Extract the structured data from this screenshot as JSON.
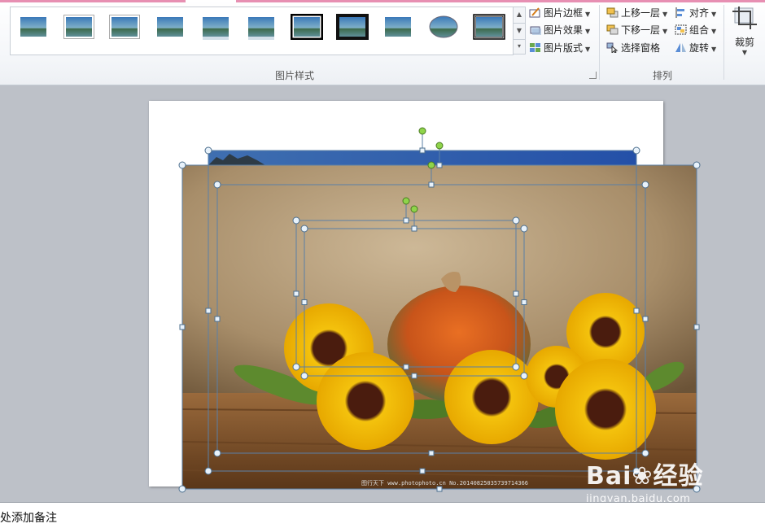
{
  "ribbon": {
    "gallery": {
      "styles": [
        "plain",
        "white-border",
        "soft-frame",
        "soft-edge",
        "reflection",
        "soft-reflection",
        "thick-black-frame",
        "black-frame",
        "thin-frame",
        "oval",
        "double-frame"
      ]
    },
    "picture_styles": {
      "border_label": "图片边框",
      "effects_label": "图片效果",
      "layout_label": "图片版式",
      "group_label": "图片样式"
    },
    "arrange": {
      "bring_forward_label": "上移一层",
      "send_backward_label": "下移一层",
      "selection_pane_label": "选择窗格",
      "align_label": "对齐",
      "group_label_btn": "组合",
      "rotate_label": "旋转",
      "group_label": "排列"
    },
    "size": {
      "crop_label": "裁剪"
    }
  },
  "slide": {
    "credit_text": "图行天下 www.photophoto.cn  No.20140825035739714366"
  },
  "watermark": {
    "brand": "Bai",
    "brand2": "经验",
    "url": "jingyan.baidu.com"
  },
  "notes": {
    "placeholder": "处添加备注"
  },
  "colors": {
    "accent_pink": "#e78fb2",
    "workspace": "#bdc1c8",
    "selection_line": "#5a7fa6",
    "rotate_handle": "#8fd44a"
  }
}
